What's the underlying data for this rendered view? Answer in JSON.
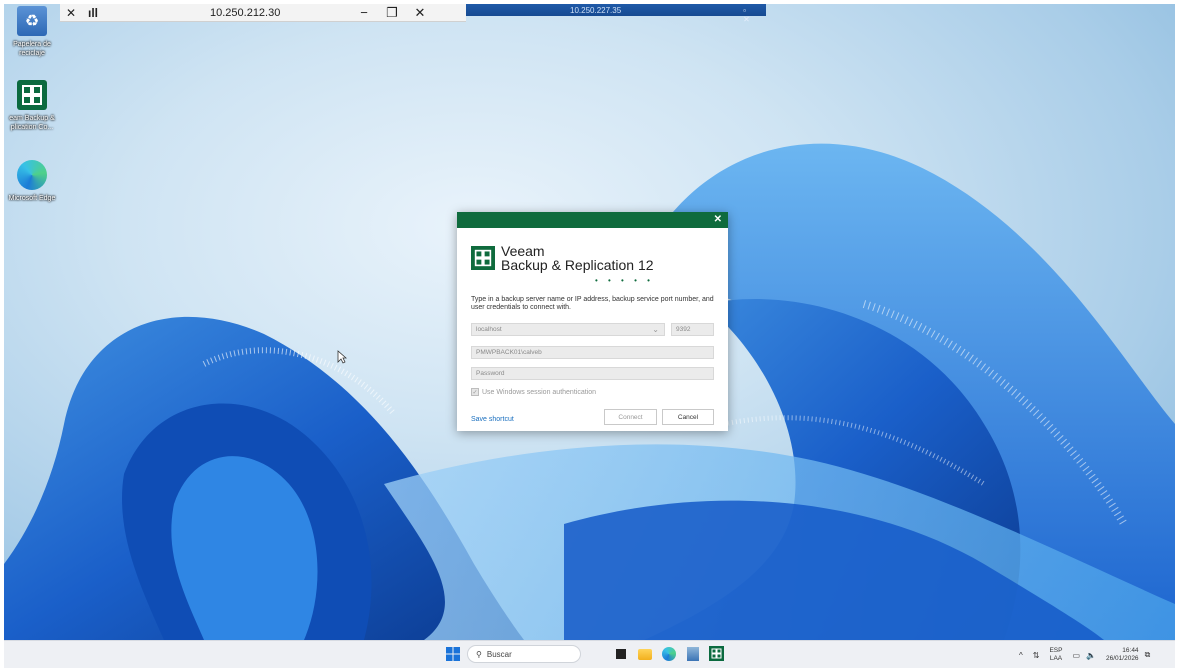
{
  "remote_bar": {
    "ip": "10.250.212.30",
    "minimize": "−",
    "restore": "❐",
    "close": "✕"
  },
  "remote_bar2": {
    "ip": "10.250.227.35",
    "controls": "– ▫ ✕"
  },
  "desktop_icons": [
    {
      "label": "Papelera de\nreciclaje"
    },
    {
      "label": "eam Backup &\nplication Co..."
    },
    {
      "label": "Microsoft Edge"
    }
  ],
  "dialog": {
    "close": "✕",
    "brand_line1": "Veeam",
    "brand_line2": "Backup & Replication 12",
    "dots": "• • • •   •",
    "instructions": "Type in a backup server name or IP address, backup service port number, and user credentials to connect with.",
    "server": {
      "value": "localhost"
    },
    "port": {
      "value": "9392"
    },
    "username": {
      "value": "PMWPBACK01\\calveb"
    },
    "password": {
      "placeholder": "Password"
    },
    "use_windows_auth": {
      "label": "Use Windows session authentication",
      "checked": true
    },
    "save_shortcut": "Save shortcut",
    "connect": "Connect",
    "cancel": "Cancel"
  },
  "taskbar": {
    "search_placeholder": "Buscar",
    "language_top": "ESP",
    "language_bottom": "LAA",
    "time": "16:44",
    "date": "26/01/2026"
  },
  "colors": {
    "veeam_green": "#0f6b3d",
    "accent_blue": "#1a6fbf"
  }
}
